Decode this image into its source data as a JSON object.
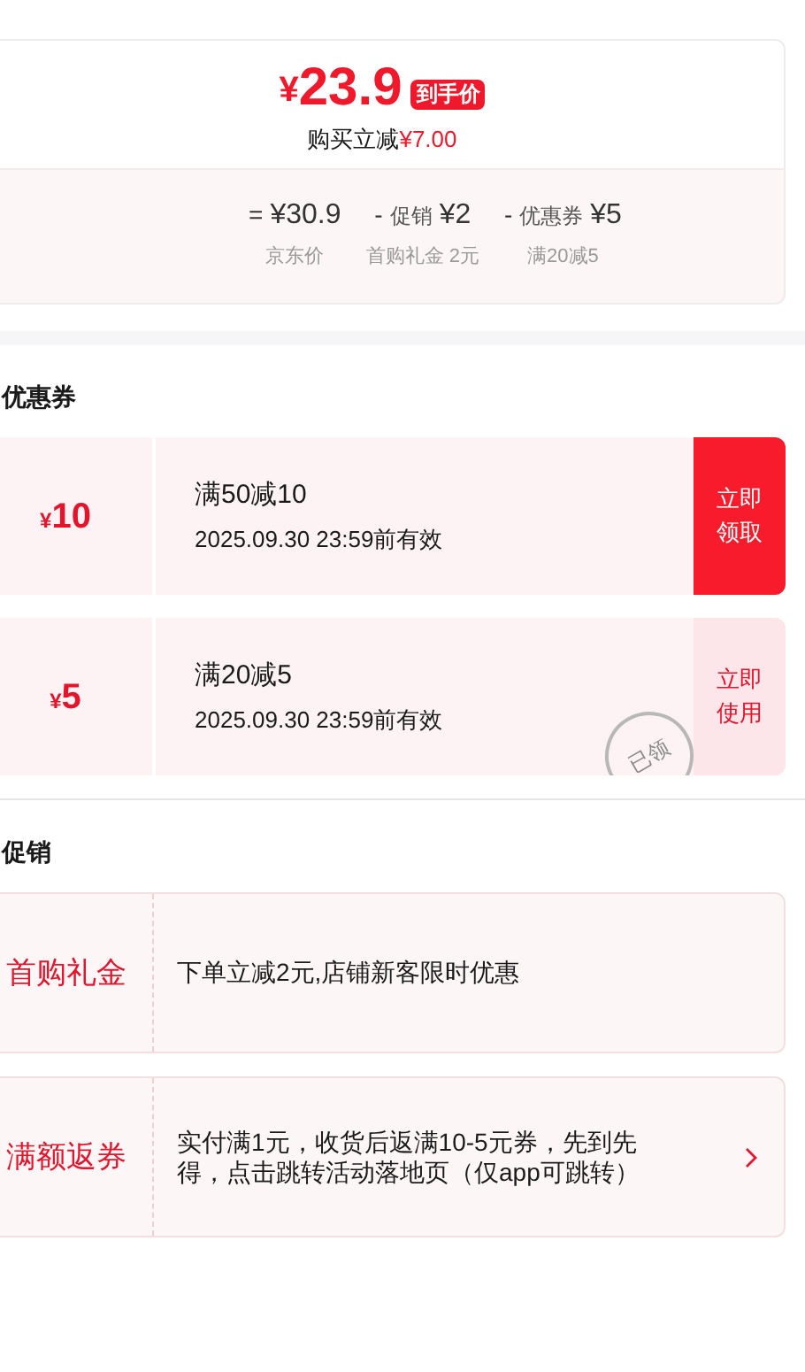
{
  "price": {
    "currency": "¥",
    "amount": "23.9",
    "badge": "到手价",
    "saving_label": "购买立减",
    "saving": "¥7.00"
  },
  "breakdown": [
    {
      "op": "=",
      "value": "¥30.9",
      "note": "京东价"
    },
    {
      "op": "-",
      "name": "促销",
      "value": "¥2",
      "note": "首购礼金 2元"
    },
    {
      "op": "-",
      "name": "优惠券",
      "value": "¥5",
      "note": "满20减5"
    }
  ],
  "coupons": {
    "title": "优惠券",
    "items": [
      {
        "currency": "¥",
        "amount": "10",
        "condition": "满50减10",
        "validity": "2025.09.30 23:59前有效",
        "action": "立即领取",
        "claimed": false
      },
      {
        "currency": "¥",
        "amount": "5",
        "condition": "满20减5",
        "validity": "2025.09.30 23:59前有效",
        "action": "立即使用",
        "claimed": true,
        "stamp": "已领"
      }
    ]
  },
  "promotions": {
    "title": "促销",
    "items": [
      {
        "label": "首购礼金",
        "text": "下单立减2元,店铺新客限时优惠",
        "linked": false
      },
      {
        "label": "满额返券",
        "text": "实付满1元，收货后返满10-5元券，先到先得，点击跳转活动落地页（仅app可跳转）",
        "linked": true
      }
    ]
  }
}
